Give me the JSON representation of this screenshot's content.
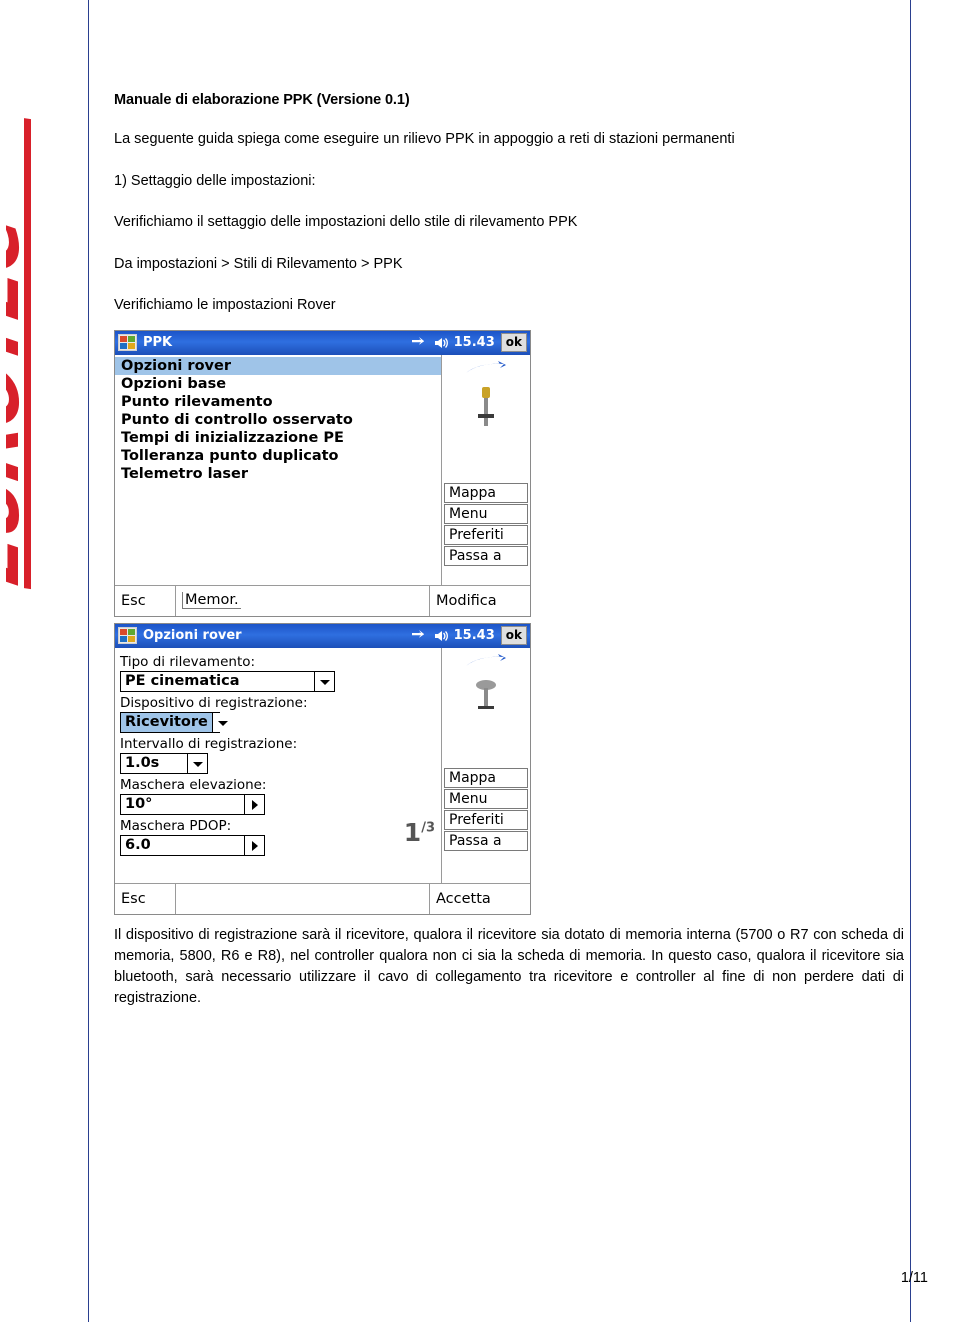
{
  "document": {
    "title": "Manuale di elaborazione PPK (Versione 0.1)",
    "intro": "La seguente guida spiega come eseguire un rilievo PPK in appoggio a reti di stazioni permanenti",
    "step1": "1) Settaggio delle impostazioni:",
    "step1_detail": "Verifichiamo il settaggio delle impostazioni dello stile di rilevamento PPK",
    "path": "Da impostazioni > Stili di Rilevamento > PPK",
    "rover_check": "Verifichiamo le impostazioni Rover",
    "closing_paragraph": "Il dispositivo di registrazione sarà il ricevitore, qualora il ricevitore sia dotato di memoria interna (5700 o R7 con scheda di memoria, 5800, R6 e R8), nel controller qualora non ci sia la scheda di memoria. In questo caso, qualora il ricevitore sia bluetooth, sarà necessario utilizzare il cavo di collegamento tra ricevitore e controller al fine di non perdere dati di registrazione.",
    "page_number": "1/11",
    "logo_text": "EUROTEC"
  },
  "screenshot1": {
    "title": "PPK",
    "clock": "15.43",
    "ok_label": "ok",
    "menu_items": [
      {
        "label": "Opzioni rover",
        "selected": true
      },
      {
        "label": "Opzioni base",
        "selected": false
      },
      {
        "label": "Punto rilevamento",
        "selected": false
      },
      {
        "label": "Punto di controllo osservato",
        "selected": false
      },
      {
        "label": "Tempi di inizializzazione PE",
        "selected": false
      },
      {
        "label": "Tolleranza punto duplicato",
        "selected": false
      },
      {
        "label": "Telemetro laser",
        "selected": false
      }
    ],
    "side_buttons": [
      "Mappa",
      "Menu",
      "Preferiti",
      "Passa a"
    ],
    "footer": {
      "esc": "Esc",
      "mem": "Memor.",
      "action": "Modifica"
    }
  },
  "screenshot2": {
    "title": "Opzioni rover",
    "clock": "15.43",
    "ok_label": "ok",
    "fields": [
      {
        "label": "Tipo di rilevamento:",
        "value": "PE cinematica",
        "highlighted": false,
        "arrow": "down",
        "width": "w-215"
      },
      {
        "label": "Dispositivo di registrazione:",
        "value": "Ricevitore",
        "highlighted": true,
        "arrow": "down",
        "width": "w-100"
      },
      {
        "label": "Intervallo di registrazione:",
        "value": "1.0s",
        "highlighted": false,
        "arrow": "down",
        "width": "w-88"
      },
      {
        "label": "Maschera elevazione:",
        "value": "10°",
        "highlighted": false,
        "arrow": "right",
        "width": "w-145"
      },
      {
        "label": "Maschera PDOP:",
        "value": "6.0",
        "highlighted": false,
        "arrow": "right",
        "width": "w-145"
      }
    ],
    "page_indicator": "1",
    "page_indicator_sup": "/3",
    "side_buttons": [
      "Mappa",
      "Menu",
      "Preferiti",
      "Passa a"
    ],
    "footer": {
      "esc": "Esc",
      "mem": "",
      "action": "Accetta"
    }
  },
  "colors": {
    "border_blue": "#2a3f8f",
    "logo_red": "#d8202a",
    "title_bar_blue": "#2f6fe0",
    "selection_blue": "#9fc4e8"
  }
}
